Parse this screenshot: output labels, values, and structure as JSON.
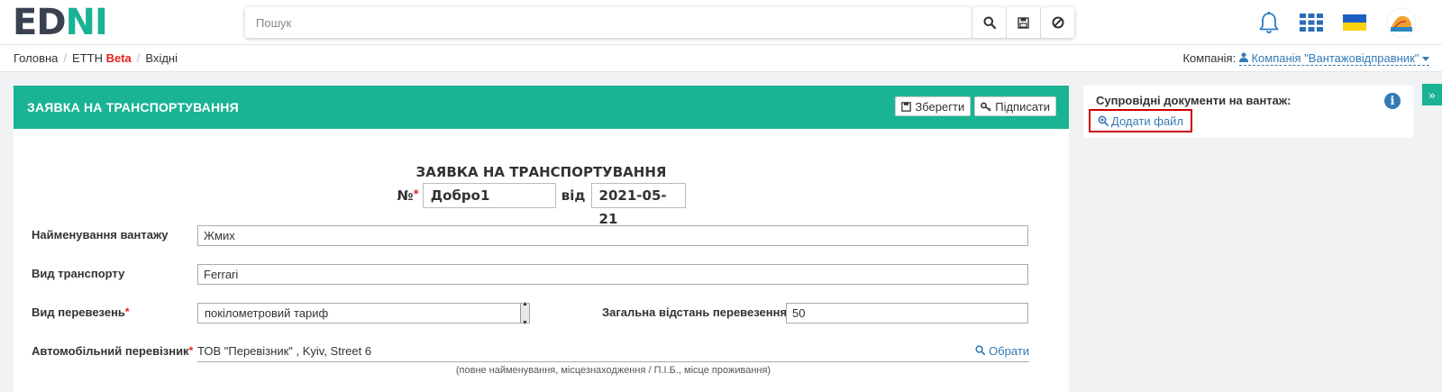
{
  "logo": {
    "part1": "ED",
    "part2": "NI"
  },
  "search": {
    "placeholder": "Пошук"
  },
  "topbar_icons": [
    "bell-icon",
    "apps-grid-icon",
    "ukraine-flag-icon",
    "avatar"
  ],
  "breadcrumb": {
    "home": "Головна",
    "section": "ЕТТН",
    "beta": "Beta",
    "current": "Вхідні"
  },
  "company": {
    "label": "Компанія:",
    "value": "Компанія \"Вантажовідправник\""
  },
  "panel": {
    "header_title": "ЗАЯВКА НА ТРАНСПОРТУВАННЯ",
    "save_label": "Зберегти",
    "sign_label": "Підписати"
  },
  "document": {
    "title": "ЗАЯВКА НА ТРАНСПОРТУВАННЯ",
    "number_label": "№",
    "number_value": "Добро1",
    "date_label": "від",
    "date_value": "2021-05-21"
  },
  "form": {
    "cargo_name_label": "Найменування вантажу",
    "cargo_name_value": "Жмих",
    "transport_type_label": "Вид транспорту",
    "transport_type_value": "Ferrari",
    "carriage_type_label": "Вид перевезень",
    "carriage_type_value": "покілометровий тариф",
    "distance_label": "Загальна відстань перевезення",
    "distance_value": "50",
    "carrier_label": "Автомобільний перевізник",
    "carrier_value": "ТОВ \"Перевізник\" , Kyiv, Street 6",
    "carrier_choose": "Обрати",
    "carrier_hint": "(повне найменування, місцезнаходження / П.І.Б., місце проживання)"
  },
  "side": {
    "title": "Супровідні документи на вантаж:",
    "add_file_label": "Додати файл",
    "collapse_glyph": "»"
  },
  "colors": {
    "accent": "#1ab394",
    "link": "#337ab7",
    "required": "#e2231a",
    "highlight": "#cc0000"
  }
}
